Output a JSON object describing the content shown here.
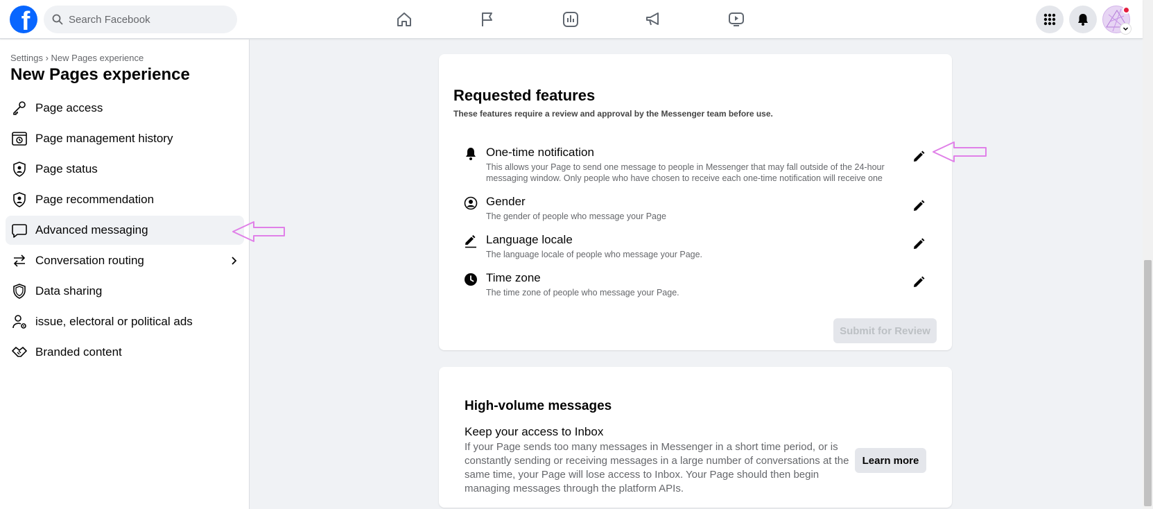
{
  "topbar": {
    "logo_letter": "f",
    "search_placeholder": "Search Facebook",
    "nav": [
      "home-icon",
      "flag-icon",
      "insights-icon",
      "megaphone-icon",
      "video-icon"
    ],
    "right": [
      "menu-grid-icon",
      "notifications-icon",
      "avatar"
    ],
    "notification_color": "#e41e3f"
  },
  "sidebar": {
    "breadcrumb": "Settings › New Pages experience",
    "title": "New Pages experience",
    "items": [
      {
        "label": "Page access",
        "icon": "key-icon"
      },
      {
        "label": "Page management history",
        "icon": "history-icon"
      },
      {
        "label": "Page status",
        "icon": "shield-person-icon"
      },
      {
        "label": "Page recommendation",
        "icon": "shield-person-icon"
      },
      {
        "label": "Advanced messaging",
        "icon": "chat-bubble-icon",
        "active": true
      },
      {
        "label": "Conversation routing",
        "icon": "swap-arrows-icon",
        "has_chevron": true
      },
      {
        "label": "Data sharing",
        "icon": "shield-icon"
      },
      {
        "label": "issue, electoral or political ads",
        "icon": "person-gear-icon"
      },
      {
        "label": "Branded content",
        "icon": "handshake-icon"
      }
    ]
  },
  "requested_features": {
    "title": "Requested features",
    "subtitle": "These features require a review and approval by the Messenger team before use.",
    "items": [
      {
        "name": "One-time notification",
        "description": "This allows your Page to send one message to people in Messenger that may fall outside of the 24-hour messaging window. Only people who have chosen to receive each one-time notification will receive one",
        "icon": "bell-icon"
      },
      {
        "name": "Gender",
        "description": "The gender of people who message your Page",
        "icon": "person-circle-icon"
      },
      {
        "name": "Language locale",
        "description": "The language locale of people who message your Page.",
        "icon": "pencil-line-icon"
      },
      {
        "name": "Time zone",
        "description": "The time zone of people who message your Page.",
        "icon": "clock-icon"
      }
    ],
    "submit_label": "Submit for Review"
  },
  "high_volume": {
    "title": "High-volume messages",
    "subtitle": "Keep your access to Inbox",
    "body": "If your Page sends too many messages in Messenger in a short time period, or is constantly sending or receiving messages in a large number of conversations at the same time, your Page will lose access to Inbox. Your Page should then begin managing messages through the platform APIs.",
    "button": "Learn more"
  },
  "annotation_color": "#e080e8"
}
